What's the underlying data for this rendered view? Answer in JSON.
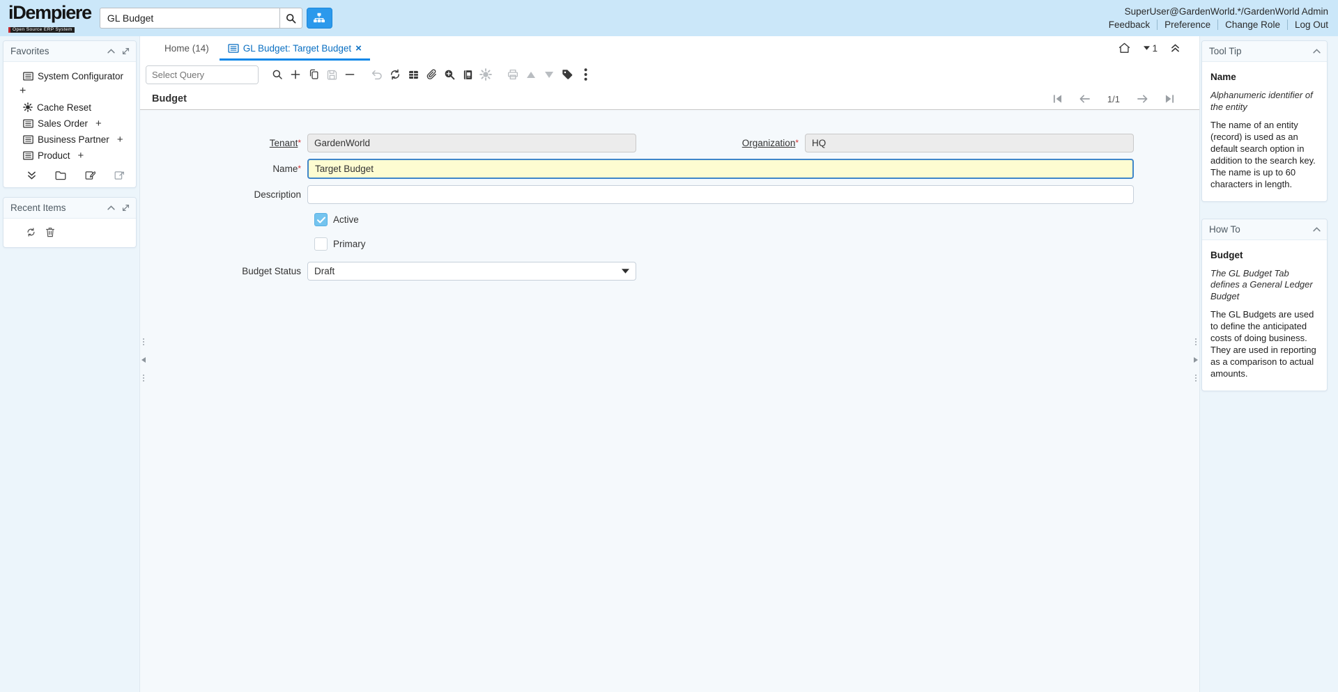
{
  "colors": {
    "header_bg": "#cbe7f9",
    "accent_blue": "#0d87e8",
    "active_tab_text": "#0a6fc2",
    "mandatory_field_bg": "#fdfcd1",
    "focused_border": "#3f86c9",
    "checkbox_checked": "#74c4ef",
    "readonly_field_bg": "#ececec"
  },
  "header": {
    "logo": {
      "title": "iDempiere",
      "subtitle": "Open Source ERP System"
    },
    "search": {
      "value": "GL Budget"
    },
    "user": "SuperUser@GardenWorld.*/GardenWorld Admin",
    "menu": {
      "feedback": "Feedback",
      "preference": "Preference",
      "change_role": "Change Role",
      "log_out": "Log Out"
    }
  },
  "sidebar": {
    "favorites": {
      "title": "Favorites",
      "plus": "+",
      "items": {
        "system_configurator": "System Configurator",
        "cache_reset": "Cache Reset",
        "sales_order": "Sales Order",
        "business_partner": "Business Partner",
        "product": "Product"
      }
    },
    "recent": {
      "title": "Recent Items"
    }
  },
  "tabs": {
    "home": "Home (14)",
    "active": "GL Budget: Target Budget",
    "desktop_count": "1"
  },
  "toolbar": {
    "query_placeholder": "Select Query"
  },
  "content": {
    "title": "Budget",
    "record_position": "1/1",
    "required_marker": "*",
    "form": {
      "tenant": {
        "label": "Tenant",
        "value": "GardenWorld"
      },
      "organization": {
        "label": "Organization",
        "value": "HQ"
      },
      "name": {
        "label": "Name",
        "value": "Target Budget"
      },
      "description": {
        "label": "Description",
        "value": ""
      },
      "active": {
        "label": "Active"
      },
      "primary": {
        "label": "Primary"
      },
      "budget_status": {
        "label": "Budget Status",
        "value": "Draft"
      }
    }
  },
  "help": {
    "tooltip": {
      "title": "Tool Tip",
      "heading": "Name",
      "summary": "Alphanumeric identifier of the entity",
      "body": "The name of an entity (record) is used as an default search option in addition to the search key. The name is up to 60 characters in length."
    },
    "howto": {
      "title": "How To",
      "heading": "Budget",
      "summary": "The GL Budget Tab defines a General Ledger Budget",
      "body": "The GL Budgets are used to define the anticipated costs of doing business. They are used in reporting as a comparison to actual amounts."
    }
  }
}
